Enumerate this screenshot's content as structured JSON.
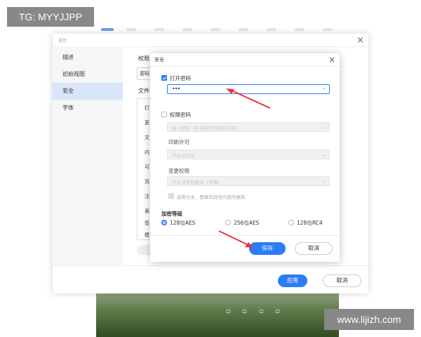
{
  "watermarks": {
    "tg": "TG: MYYJJPP",
    "site": "www.lijizh.com"
  },
  "properties": {
    "title": "属性",
    "sidebar": [
      {
        "label": "描述"
      },
      {
        "label": "初始视图"
      },
      {
        "label": "安全"
      },
      {
        "label": "字体"
      }
    ],
    "active_sidebar": "安全",
    "right_labels": {
      "permissions": "权限",
      "password": "密码",
      "file": "文件"
    },
    "list_items": [
      "打",
      "更",
      "文",
      "内",
      "可",
      "页",
      "注",
      "表",
      "签",
      "模"
    ],
    "apply_label": "应用",
    "cancel_label": "取消"
  },
  "security_dialog": {
    "title": "安全",
    "open_password": {
      "label": "打开密码",
      "checked": true,
      "value": "•••"
    },
    "permission_password": {
      "label": "权限密码",
      "checked": false,
      "placeholder": "输入密码（不可与打开密码不同）"
    },
    "print": {
      "label": "印刷许可",
      "value": "不允许打印"
    },
    "change": {
      "label": "变更权限",
      "value": "不允许任何更改（可填）"
    },
    "copy_option": {
      "label": "启用文本、图像和其他内容的复制",
      "checked": false
    },
    "encryption": {
      "label": "加密等级",
      "options": [
        "128位AES",
        "256位AES",
        "128位RC4"
      ],
      "selected": "128位AES"
    },
    "save_label": "保存",
    "cancel_label": "取消"
  },
  "colors": {
    "accent": "#2b7cf6",
    "active_sidebar_bg": "#d9e5f8",
    "arrow": "#e23b3b"
  }
}
